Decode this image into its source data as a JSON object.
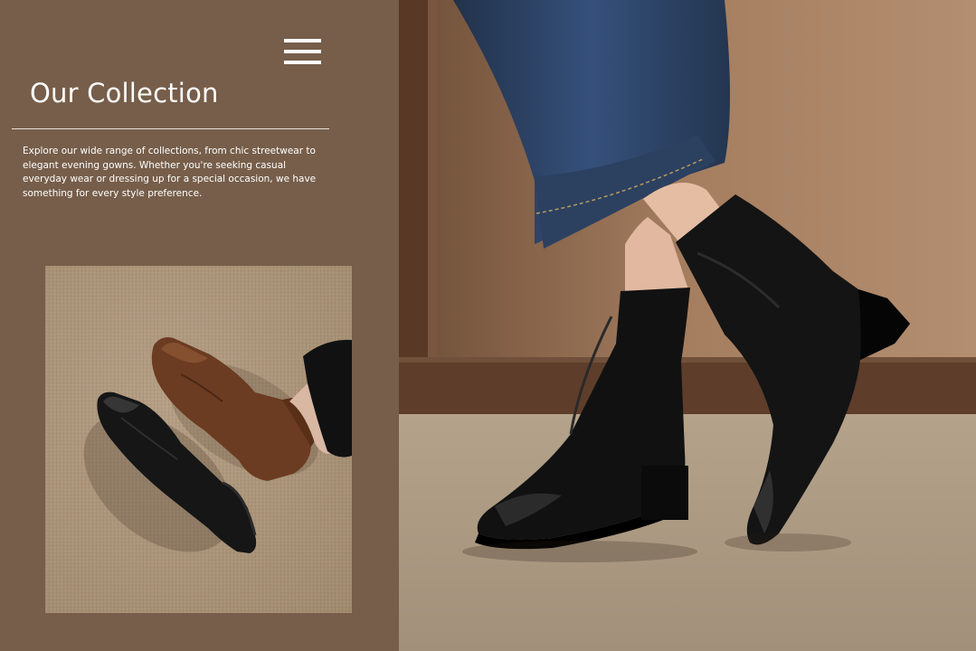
{
  "header": {
    "menu_icon": "hamburger-menu-icon",
    "title": "Our Collection"
  },
  "intro": {
    "text": "Explore our wide range of collections, from chic streetwear to elegant evening gowns. Whether you're seeking casual everyday wear or dressing up for a special occasion, we have something for every style preference."
  },
  "colors": {
    "panel_background": "#765e4a",
    "text": "#ffffff",
    "divider": "#e9e1d9"
  }
}
